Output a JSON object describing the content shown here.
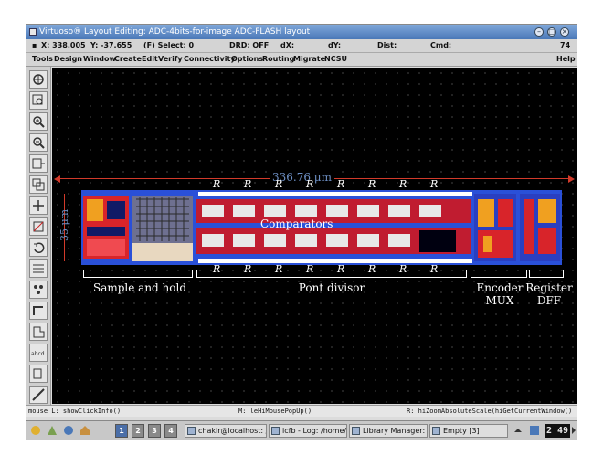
{
  "window": {
    "title": "Virtuoso® Layout Editing: ADC-4bits-for-image ADC-FLASH layout"
  },
  "status": {
    "x": "X:  338.005",
    "y": "Y:  -37.655",
    "select": "(F) Select: 0",
    "drd": "DRD: OFF",
    "dx": "dX:",
    "dy": "dY:",
    "dist": "Dist:",
    "cmd": "Cmd:",
    "num": "74"
  },
  "menubar": {
    "items": [
      "Tools",
      "Design",
      "Window",
      "Create",
      "Edit",
      "Verify",
      "Connectivity",
      "Options",
      "Routing",
      "Migrate",
      "NCSU"
    ],
    "help": "Help"
  },
  "toolbox": {
    "icons": [
      "zoom-fit-icon",
      "zoom-box-icon",
      "zoom-in-icon",
      "zoom-out-icon",
      "stretch-icon",
      "copy-icon",
      "move-icon",
      "delete-icon",
      "undo-icon",
      "property-icon",
      "instance-icon",
      "path-icon",
      "polygon-icon",
      "label-icon",
      "rectangle-icon",
      "ruler-icon"
    ],
    "label_tool_text": "abcd"
  },
  "layout": {
    "width_label": "336.76 μm",
    "height_label": "35 μm",
    "r_label": "R",
    "comparators_label": "Comparators",
    "blocks": {
      "sample_hold": "Sample and hold",
      "pont_divisor": "Pont divisor",
      "encoder_1": "Encoder",
      "encoder_2": "MUX",
      "register_1": "Register",
      "register_2": "DFF"
    }
  },
  "cmdline": {
    "left": "mouse L: showClickInfo()",
    "mid": "M: leHiMousePopUp()",
    "right": "R: hiZoomAbsoluteScale(hiGetCurrentWindow()"
  },
  "taskbar": {
    "workspaces": [
      "1",
      "2",
      "3",
      "4"
    ],
    "active_workspace": "1",
    "items": [
      {
        "label": "chakir@localhost: /h",
        "icon": "terminal-icon"
      },
      {
        "label": "icfb - Log: /home/ch",
        "icon": "x-icon"
      },
      {
        "label": "Library Manager: W",
        "icon": "window-icon"
      },
      {
        "label": "Empty [3]",
        "icon": "window-icon"
      }
    ],
    "clock": "2 49"
  },
  "colors": {
    "title_blue": "#4a78b8",
    "canvas_bg": "#000000",
    "metal_blue": "#2a50d8",
    "poly_red": "#d8242a",
    "diff_orange": "#f0a020",
    "measure_red": "#d23a2a",
    "label_blue": "#6d8fc4"
  }
}
